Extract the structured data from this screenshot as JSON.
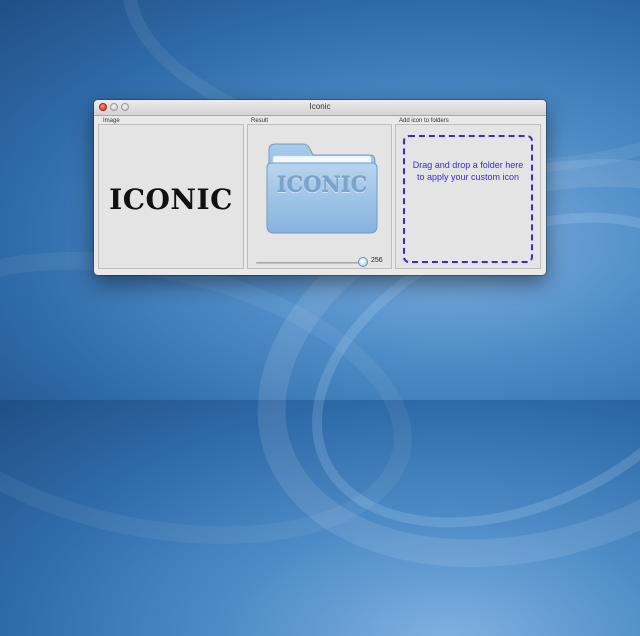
{
  "window": {
    "title": "Iconic"
  },
  "panels": {
    "image": {
      "label": "Image",
      "preview_text": "ICONIC"
    },
    "result": {
      "label": "Result",
      "folder_text": "ICONIC",
      "size_value": "256",
      "size_fraction": 1.0
    },
    "add": {
      "label": "Add icon to folders",
      "drop_text": "Drag and drop a folder here to apply your custom icon"
    }
  },
  "colors": {
    "drop_accent": "#3a2bd1",
    "folder_blue": "#8fb9e1"
  }
}
